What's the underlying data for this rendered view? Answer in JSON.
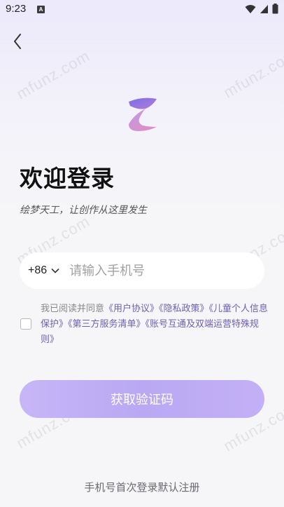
{
  "status_bar": {
    "time": "9:23",
    "badge": "A"
  },
  "watermark": "mfunz.com",
  "header": {
    "back_icon": "chevron-left-icon"
  },
  "login": {
    "title": "欢迎登录",
    "subtitle": "绘梦天工，让创作从这里发生"
  },
  "phone": {
    "country_code": "+86",
    "placeholder": "请输入手机号",
    "value": ""
  },
  "agreement": {
    "checked": false,
    "prefix": "我已阅读并同意",
    "links": [
      "《用户协议》",
      "《隐私政策》",
      "《儿童个人信息保护》",
      "《第三方服务清单》",
      "《账号互通及双端运营特殊规则》"
    ]
  },
  "actions": {
    "get_code_label": "获取验证码"
  },
  "footer": {
    "note": "手机号首次登录默认注册"
  },
  "colors": {
    "accent": "#b9a8f3",
    "link": "#6e5fb8",
    "background": "#f6f6f8"
  }
}
